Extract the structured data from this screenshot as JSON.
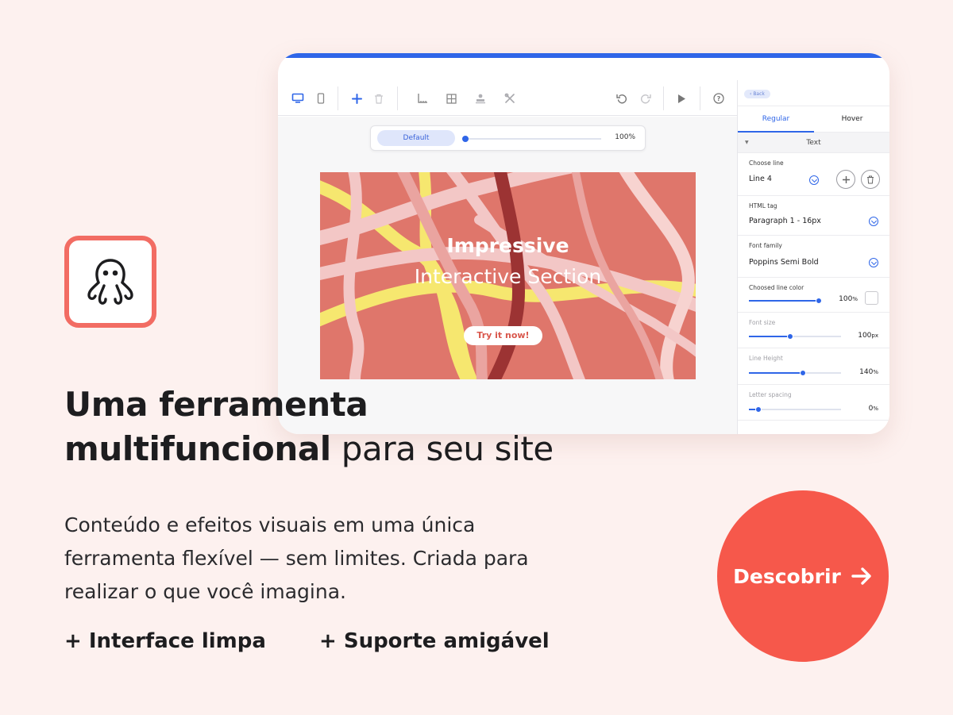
{
  "brand": {
    "icon": "octopus-icon",
    "accent": "#f26c63"
  },
  "editor": {
    "toolbar": {
      "icons": [
        "desktop-icon",
        "mobile-icon",
        "add-icon",
        "trash-icon",
        "ruler-icon",
        "grid-icon",
        "stamp-icon",
        "tools-icon",
        "undo-icon",
        "redo-icon",
        "play-icon",
        "help-icon"
      ]
    },
    "state_bar": {
      "state": "Default",
      "zoom": "100%",
      "zoom_fraction": 0.02
    },
    "hero": {
      "title": "Impressive",
      "subtitle": "Interactive Section",
      "button": "Try it now!",
      "background": "#df766b"
    },
    "panel": {
      "back": "Back",
      "tabs": [
        "Regular",
        "Hover"
      ],
      "section": "Text",
      "choose_line": {
        "label": "Choose line",
        "value": "Line 4"
      },
      "html_tag": {
        "label": "HTML tag",
        "value": "Paragraph 1 - 16px"
      },
      "font_family": {
        "label": "Font family",
        "value": "Poppins Semi Bold"
      },
      "line_color": {
        "label": "Choosed line color",
        "value": "100",
        "unit": "%",
        "fraction": 1.0
      },
      "font_size": {
        "label": "Font size",
        "value": "100",
        "unit": "px",
        "fraction": 0.45
      },
      "line_height": {
        "label": "Line Height",
        "value": "140",
        "unit": "%",
        "fraction": 0.59
      },
      "letter_spacing": {
        "label": "Letter spacing",
        "value": "0",
        "unit": "%",
        "fraction": 0.1
      }
    }
  },
  "marketing": {
    "headline_bold_1": "Uma ferramenta",
    "headline_bold_2": "multifuncional",
    "headline_regular": "para seu site",
    "body_line_1": "Conteúdo e efeitos visuais em uma única",
    "body_line_2": "ferramenta flexível — sem limites. Criada para",
    "body_line_3": "realizar o que você imagina.",
    "feature_1": "+ Interface limpa",
    "feature_2": "+ Suporte amigável",
    "cta": "Descobrir",
    "cta_color": "#f6584b"
  }
}
